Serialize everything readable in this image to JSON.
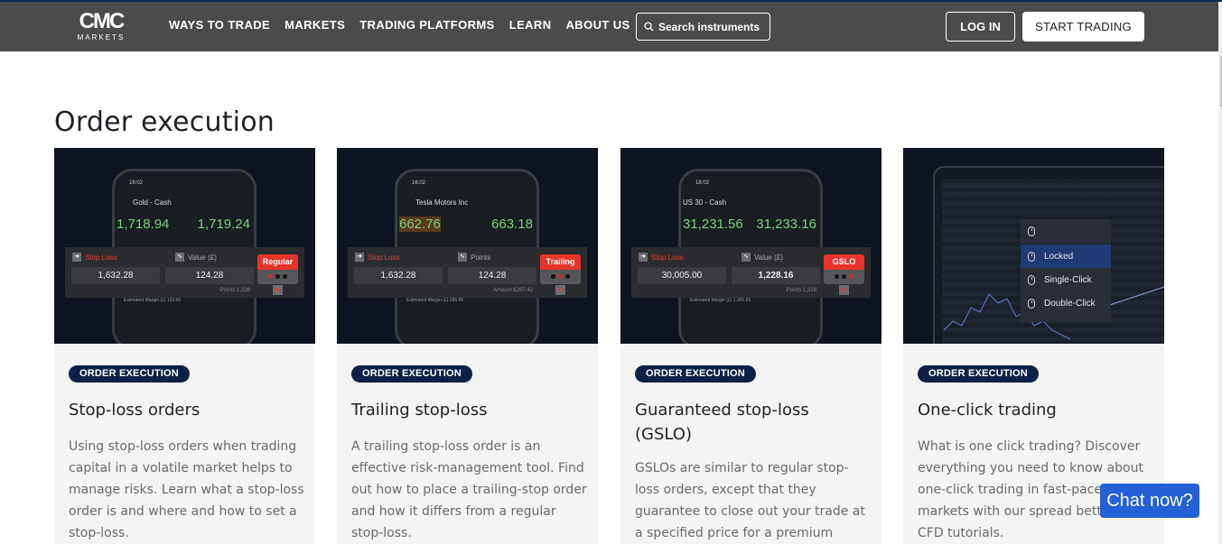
{
  "header": {
    "logo_main": "CMC",
    "logo_sub": "MARKETS",
    "nav": [
      "WAYS TO TRADE",
      "MARKETS",
      "TRADING PLATFORMS",
      "LEARN",
      "ABOUT US"
    ],
    "search_label": "Search instruments",
    "login_label": "LOG IN",
    "start_label": "START TRADING"
  },
  "section": {
    "title": "Order execution"
  },
  "cards": [
    {
      "tag": "ORDER EXECUTION",
      "title": "Stop-loss orders",
      "description": "Using stop-loss orders when trading capital in a volatile market helps to manage risks. Learn what a stop-loss order is and where and how to set a stop-loss.",
      "image": {
        "time": "16:02",
        "instrument": "Gold - Cash",
        "sell": "1,718.94",
        "buy": "1,719.24",
        "stop_label": "Stop Loss",
        "value_label": "Value (£)",
        "stop_value": "1,632.28",
        "value": "124.28",
        "type": "Regular",
        "footer": "Points 1,228",
        "lower": "Estimated Margin (£)  123.66"
      }
    },
    {
      "tag": "ORDER EXECUTION",
      "title": "Trailing stop-loss",
      "description": "A trailing stop-loss order is an effective risk-management tool. Find out how to place a trailing-stop order and how it differs from a regular stop-loss.",
      "image": {
        "time": "16:02",
        "instrument": "Tesla Motors Inc",
        "sell": "662.76",
        "buy": "663.18",
        "stop_label": "Stop Loss",
        "value_label": "Points",
        "stop_value": "1,632.28",
        "value": "124.28",
        "type": "Trailing",
        "footer": "Amount £287.42",
        "lower": "Estimated Margin (£)  286.09"
      }
    },
    {
      "tag": "ORDER EXECUTION",
      "title": "Guaranteed stop-loss (GSLO)",
      "description": "GSLOs are similar to regular stop-loss orders, except that they guarantee to close out your trade at a specified price for a premium",
      "image": {
        "time": "16:02",
        "instrument": "US 30 - Cash",
        "sell": "31,231.56",
        "buy": "31,233.16",
        "stop_label": "Stop Loss",
        "value_label": "Value (£)",
        "stop_value": "30,005.00",
        "value": "1,228.16",
        "type": "GSLO",
        "footer": "Points 1,228",
        "lower": "Estimated Margin (£)  1,001.62"
      }
    },
    {
      "tag": "ORDER EXECUTION",
      "title": "One-click trading",
      "description": "What is one click trading? Discover everything you need to know about one-click trading in fast-paced markets with our spread betting and CFD tutorials.",
      "image": {
        "menu": [
          "Locked",
          "Single-Click",
          "Double-Click"
        ]
      }
    }
  ],
  "chat": {
    "label": "Chat now?"
  },
  "colors": {
    "header_bg": "#4b4b4b",
    "tag_bg": "#0d2148",
    "accent_red": "#e8332a",
    "chat_blue": "#2460d6"
  }
}
